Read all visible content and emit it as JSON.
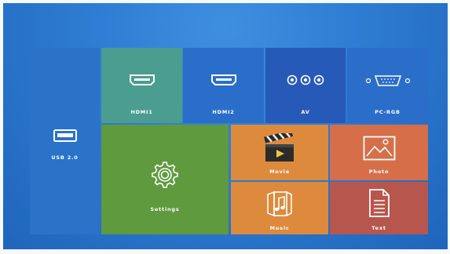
{
  "tiles": {
    "usb": {
      "label": "USB 2.0",
      "icon": "usb-icon"
    },
    "hdmi1": {
      "label": "HDMI1",
      "icon": "hdmi-port-icon"
    },
    "hdmi2": {
      "label": "HDMI2",
      "icon": "hdmi-port-icon"
    },
    "av": {
      "label": "AV",
      "icon": "av-jacks-icon"
    },
    "pcrgb": {
      "label": "PC-RGB",
      "icon": "vga-port-icon"
    },
    "settings": {
      "label": "Settings",
      "icon": "gear-icon"
    },
    "movie": {
      "label": "Movie",
      "icon": "clapperboard-icon"
    },
    "photo": {
      "label": "Photo",
      "icon": "image-icon"
    },
    "music": {
      "label": "Music",
      "icon": "music-note-icon"
    },
    "text": {
      "label": "Text",
      "icon": "document-icon"
    }
  },
  "colors": {
    "background": "#2f7dd4",
    "usb": "#2a73c9",
    "hdmi1": "#4a9d8f",
    "hdmi2": "#2a6ec9",
    "av": "#2659b8",
    "pcrgb": "#2a6ec9",
    "settings": "#5f9a3e",
    "movie": "#dd8a3c",
    "photo": "#d66f49",
    "music": "#dd8a3c",
    "text": "#b7564c"
  }
}
